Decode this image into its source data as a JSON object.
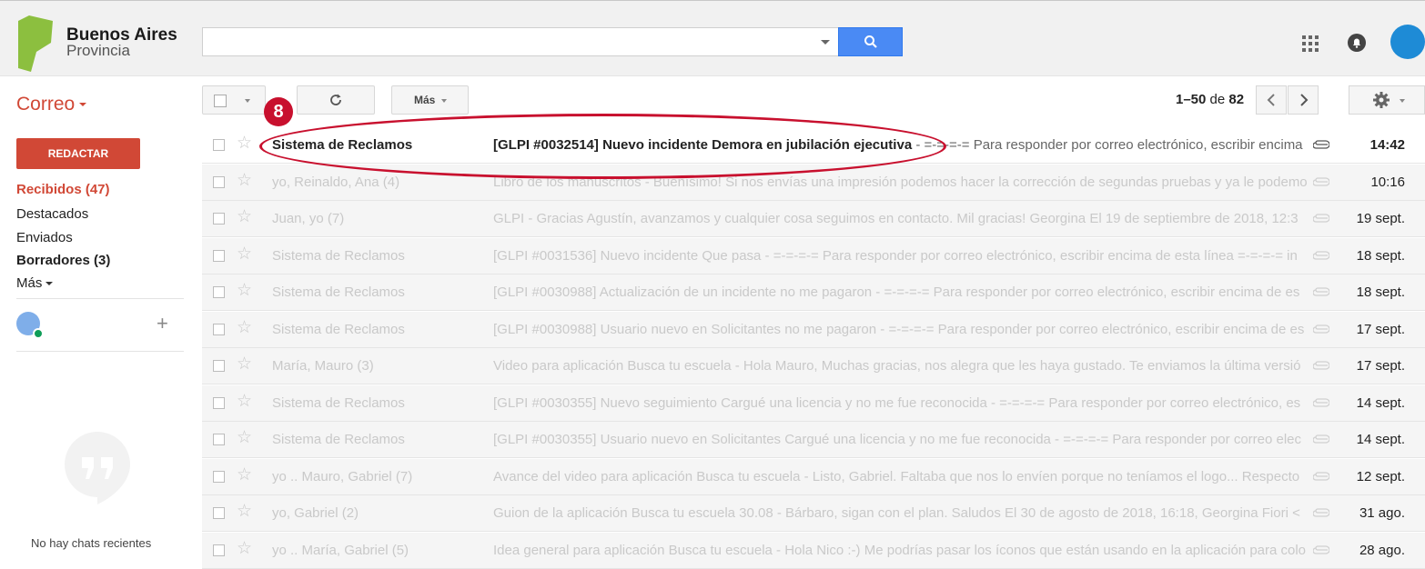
{
  "brand": {
    "title": "Buenos Aires",
    "subtitle": "Provincia",
    "color": "#8cbf3f"
  },
  "search": {
    "value": "",
    "placeholder": ""
  },
  "toolbar": {
    "app_label": "Correo",
    "more_label": "Más",
    "pager": {
      "range": "1–50",
      "of": "de",
      "total": "82"
    }
  },
  "sidebar": {
    "compose_label": "REDACTAR",
    "items": [
      {
        "label": "Recibidos (47)"
      },
      {
        "label": "Destacados"
      },
      {
        "label": "Enviados"
      },
      {
        "label": "Borradores (3)"
      },
      {
        "label": "Más"
      }
    ],
    "no_chats": "No hay chats recientes"
  },
  "annotation": {
    "badge": "8"
  },
  "emails": [
    {
      "sender": "Sistema de Reclamos",
      "subject": "[GLPI #0032514] Nuevo incidente Demora en jubilación ejecutiva",
      "snippet": " - =-=-=-= Para responder por correo electrónico, escribir encima de esta línea =-=-=-= in",
      "date": "14:42",
      "unread": true
    },
    {
      "sender": "yo, Reinaldo, Ana (4)",
      "subject": "Libro de los manuscritos - Buenísimo! Si nos envías una impresión podemos hacer la corrección de segundas pruebas y ya le podemos",
      "snippet": "",
      "date": "10:16",
      "unread": false
    },
    {
      "sender": "Juan, yo (7)",
      "subject": "GLPI - Gracias Agustín, avanzamos y cualquier cosa seguimos en contacto. Mil gracias! Georgina El 19 de septiembre de 2018, 12:3",
      "snippet": "",
      "date": "19 sept.",
      "unread": false
    },
    {
      "sender": "Sistema de Reclamos",
      "subject": "[GLPI #0031536] Nuevo incidente Que pasa - =-=-=-= Para responder por correo electrónico, escribir encima de esta línea =-=-=-= in",
      "snippet": "",
      "date": "18 sept.",
      "unread": false
    },
    {
      "sender": "Sistema de Reclamos",
      "subject": "[GLPI #0030988] Actualización de un incidente no me pagaron - =-=-=-= Para responder por correo electrónico, escribir encima de es",
      "snippet": "",
      "date": "18 sept.",
      "unread": false
    },
    {
      "sender": "Sistema de Reclamos",
      "subject": "[GLPI #0030988] Usuario nuevo en Solicitantes no me pagaron - =-=-=-= Para responder por correo electrónico, escribir encima de es",
      "snippet": "",
      "date": "17 sept.",
      "unread": false
    },
    {
      "sender": "María, Mauro (3)",
      "subject": "Video para aplicación Busca tu escuela - Hola Mauro, Muchas gracias, nos alegra que les haya gustado. Te enviamos la última versió",
      "snippet": "",
      "date": "17 sept.",
      "unread": false
    },
    {
      "sender": "Sistema de Reclamos",
      "subject": "[GLPI #0030355] Nuevo seguimiento Cargué una licencia y no me fue reconocida - =-=-=-= Para responder por correo electrónico, es",
      "snippet": "",
      "date": "14 sept.",
      "unread": false
    },
    {
      "sender": "Sistema de Reclamos",
      "subject": "[GLPI #0030355] Usuario nuevo en Solicitantes Cargué una licencia y no me fue reconocida - =-=-=-= Para responder por correo elec",
      "snippet": "",
      "date": "14 sept.",
      "unread": false
    },
    {
      "sender": "yo .. Mauro, Gabriel (7)",
      "subject": "Avance del video para aplicación Busca tu escuela - Listo, Gabriel. Faltaba que nos lo envíen porque no teníamos el logo... Respecto",
      "snippet": "",
      "date": "12 sept.",
      "unread": false
    },
    {
      "sender": "yo, Gabriel (2)",
      "subject": "Guion de la aplicación Busca tu escuela 30.08 - Bárbaro, sigan con el plan. Saludos El 30 de agosto de 2018, 16:18, Georgina Fiori <",
      "snippet": "",
      "date": "31 ago.",
      "unread": false
    },
    {
      "sender": "yo .. María, Gabriel (5)",
      "subject": "Idea general para aplicación Busca tu escuela - Hola Nico :-) Me podrías pasar los íconos que están usando en la aplicación para colo",
      "snippet": "",
      "date": "28 ago.",
      "unread": false
    }
  ],
  "colors": {
    "accent": "#d14836",
    "search_blue": "#4a8af4",
    "annotation": "#c8102e",
    "avatar": "#1e8bd6"
  },
  "icons": [
    "search-icon",
    "apps-grid-icon",
    "notifications-icon",
    "refresh-icon",
    "chevron-left-icon",
    "chevron-right-icon",
    "gear-icon",
    "star-icon",
    "paperclip-icon",
    "hangouts-icon",
    "plus-icon"
  ]
}
